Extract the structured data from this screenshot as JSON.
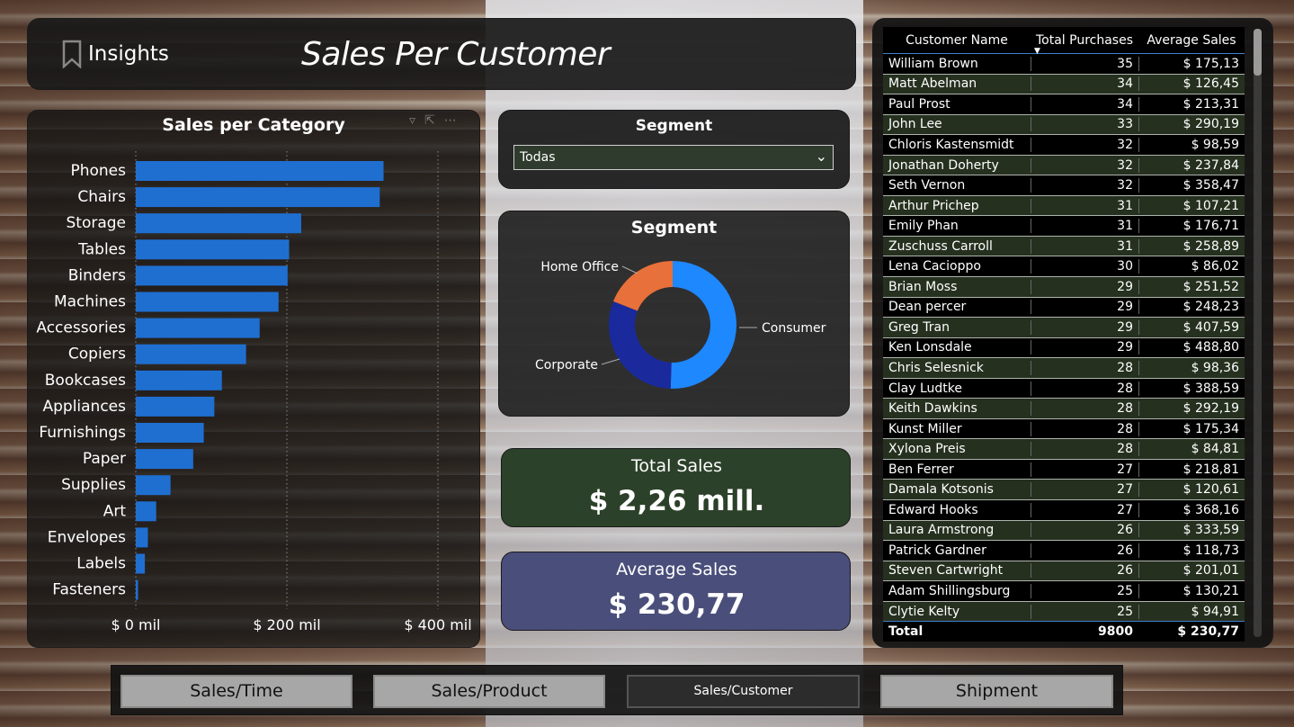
{
  "header": {
    "insights_label": "Insights",
    "title": "Sales Per Customer"
  },
  "bar_chart": {
    "title": "Sales per Category",
    "icons": [
      "filter-icon",
      "focus-mode-icon",
      "more-options-icon"
    ]
  },
  "chart_data": [
    {
      "type": "bar",
      "orientation": "horizontal",
      "title": "Sales per Category",
      "categories": [
        "Phones",
        "Chairs",
        "Storage",
        "Tables",
        "Binders",
        "Machines",
        "Accessories",
        "Copiers",
        "Bookcases",
        "Appliances",
        "Furnishings",
        "Paper",
        "Supplies",
        "Art",
        "Envelopes",
        "Labels",
        "Fasteners"
      ],
      "values": [
        328,
        323,
        219,
        203,
        201,
        189,
        164,
        146,
        114,
        104,
        90,
        76,
        46,
        27,
        16,
        12,
        3
      ],
      "unit": "mil",
      "xlim": [
        0,
        450
      ],
      "xticks": [
        0,
        200,
        400
      ],
      "xtick_labels": [
        "$ 0 mil",
        "$ 200 mil",
        "$ 400 mil"
      ],
      "bar_color": "#1f6fd1",
      "grid": "vertical dotted"
    },
    {
      "type": "pie",
      "donut": true,
      "title": "Segment",
      "labels": [
        "Consumer",
        "Corporate",
        "Home Office"
      ],
      "values": [
        50.5,
        30.5,
        19.0
      ],
      "colors": [
        "#1e88ff",
        "#1a2a9c",
        "#e8703a"
      ]
    }
  ],
  "slicer": {
    "title": "Segment",
    "selected": "Todas"
  },
  "kpi": {
    "total_label": "Total Sales",
    "total_value": "$ 2,26 mill.",
    "avg_label": "Average Sales",
    "avg_value": "$ 230,77"
  },
  "table": {
    "columns": [
      "Customer Name",
      "Total Purchases",
      "Average Sales"
    ],
    "rows": [
      [
        "William Brown",
        "35",
        "$ 175,13"
      ],
      [
        "Matt Abelman",
        "34",
        "$ 126,45"
      ],
      [
        "Paul Prost",
        "34",
        "$ 213,31"
      ],
      [
        "John Lee",
        "33",
        "$ 290,19"
      ],
      [
        "Chloris Kastensmidt",
        "32",
        "$ 98,59"
      ],
      [
        "Jonathan Doherty",
        "32",
        "$ 237,84"
      ],
      [
        "Seth Vernon",
        "32",
        "$ 358,47"
      ],
      [
        "Arthur Prichep",
        "31",
        "$ 107,21"
      ],
      [
        "Emily Phan",
        "31",
        "$ 176,71"
      ],
      [
        "Zuschuss Carroll",
        "31",
        "$ 258,89"
      ],
      [
        "Lena Cacioppo",
        "30",
        "$ 86,02"
      ],
      [
        "Brian Moss",
        "29",
        "$ 251,52"
      ],
      [
        "Dean percer",
        "29",
        "$ 248,23"
      ],
      [
        "Greg Tran",
        "29",
        "$ 407,59"
      ],
      [
        "Ken Lonsdale",
        "29",
        "$ 488,80"
      ],
      [
        "Chris Selesnick",
        "28",
        "$ 98,36"
      ],
      [
        "Clay Ludtke",
        "28",
        "$ 388,59"
      ],
      [
        "Keith Dawkins",
        "28",
        "$ 292,19"
      ],
      [
        "Kunst Miller",
        "28",
        "$ 175,34"
      ],
      [
        "Xylona Preis",
        "28",
        "$ 84,81"
      ],
      [
        "Ben Ferrer",
        "27",
        "$ 218,81"
      ],
      [
        "Damala Kotsonis",
        "27",
        "$ 120,61"
      ],
      [
        "Edward Hooks",
        "27",
        "$ 368,16"
      ],
      [
        "Laura Armstrong",
        "26",
        "$ 333,59"
      ],
      [
        "Patrick Gardner",
        "26",
        "$ 118,73"
      ],
      [
        "Steven Cartwright",
        "26",
        "$ 201,01"
      ],
      [
        "Adam Shillingsburg",
        "25",
        "$ 130,21"
      ],
      [
        "Clytie Kelty",
        "25",
        "$ 94,91"
      ]
    ],
    "total": {
      "label": "Total",
      "purchases": "9800",
      "avg": "$ 230,77"
    }
  },
  "nav": {
    "buttons": [
      "Sales/Time",
      "Sales/Product",
      "Sales/Customer",
      "Shipment"
    ],
    "active": "Sales/Customer"
  }
}
